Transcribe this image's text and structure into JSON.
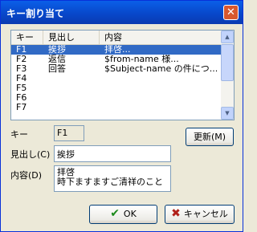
{
  "window": {
    "title": "キー割り当て",
    "close_glyph": "✕"
  },
  "list": {
    "columns": [
      "キー",
      "見出し",
      "内容"
    ],
    "rows": [
      {
        "key": "F1",
        "heading": "挨拶",
        "content": "拝啓..."
      },
      {
        "key": "F2",
        "heading": "返信",
        "content": "$from-name 様..."
      },
      {
        "key": "F3",
        "heading": "回答",
        "content": "$Subject-name の件につ..."
      },
      {
        "key": "F4",
        "heading": "",
        "content": ""
      },
      {
        "key": "F5",
        "heading": "",
        "content": ""
      },
      {
        "key": "F6",
        "heading": "",
        "content": ""
      },
      {
        "key": "F7",
        "heading": "",
        "content": ""
      }
    ],
    "selected_index": 0
  },
  "form": {
    "key_label": "キー",
    "key_value": "F1",
    "heading_label": "見出し(C)",
    "heading_value": "挨拶",
    "content_label": "内容(D)",
    "content_lines": [
      "拝啓",
      "時下ますますご清祥のこと"
    ]
  },
  "buttons": {
    "update": "更新(M)",
    "ok": "OK",
    "cancel": "キャンセル",
    "ok_icon": "check-icon",
    "cancel_icon": "x-icon"
  },
  "colors": {
    "titlebar": "#0846c8",
    "selection": "#316ac5",
    "face": "#ece9d8"
  }
}
